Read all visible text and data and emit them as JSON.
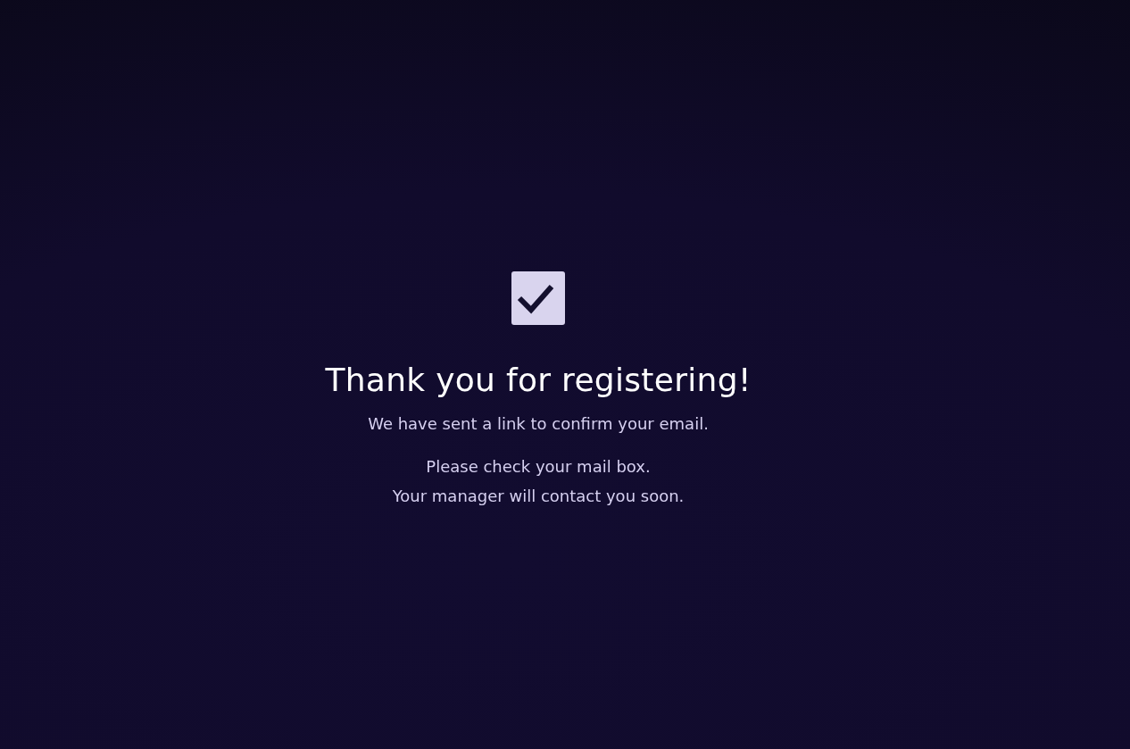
{
  "title": "Thank you for registering!",
  "message": "We have sent a link to confirm your email.",
  "notes": [
    "Please check your mail box.",
    "Your manager will contact you soon."
  ]
}
